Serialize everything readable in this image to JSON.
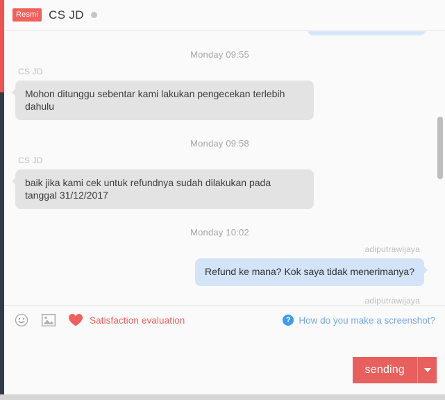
{
  "header": {
    "badge": "Resmi",
    "contact_name": "CS JD",
    "status_dot_color": "#c5c5c5",
    "badge_color": "#f2605c"
  },
  "conversation": {
    "groups": [
      {
        "timestamp": "Monday 09:55",
        "sender": "CS JD",
        "side": "left",
        "type": "text",
        "text": "Mohon ditunggu sebentar kami lakukan pengecekan terlebih dahulu"
      },
      {
        "timestamp": "Monday 09:58",
        "sender": "CS JD",
        "side": "left",
        "type": "text",
        "text": "baik jika kami cek untuk refundnya sudah dilakukan pada tanggal 31/12/2017"
      },
      {
        "timestamp": "Monday 10:02",
        "sender": "adiputrawijaya",
        "side": "right",
        "type": "text",
        "text": "Refund ke mana? Kok saya tidak menerimanya?"
      },
      {
        "timestamp": "",
        "sender": "adiputrawijaya",
        "side": "right",
        "type": "image",
        "text": ""
      }
    ]
  },
  "composer": {
    "emoji_icon": "smiley-icon",
    "image_icon": "picture-icon",
    "heart_icon": "heart-icon",
    "satisfaction_label": "Satisfaction evaluation",
    "help_icon": "?",
    "help_label": "How do you make a screenshot?",
    "input_value": "",
    "input_placeholder": "",
    "send_label": "sending",
    "send_color": "#e8605d",
    "satisfaction_color": "#f2605c",
    "help_color": "#74a9e8"
  }
}
